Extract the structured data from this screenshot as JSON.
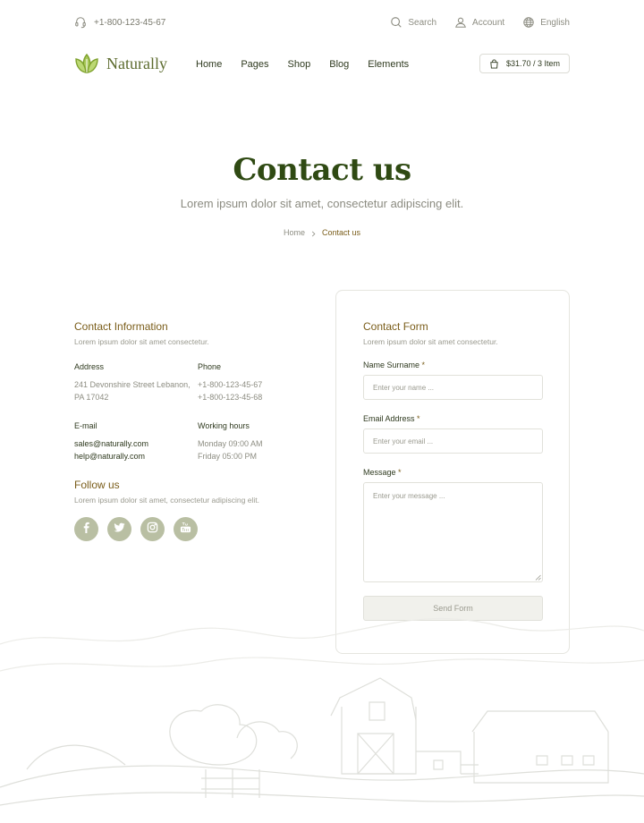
{
  "topbar": {
    "phone": "+1-800-123-45-67",
    "search_label": "Search",
    "account_label": "Account",
    "language_label": "English"
  },
  "brand": {
    "name": "Naturally"
  },
  "nav": {
    "items": [
      {
        "label": "Home"
      },
      {
        "label": "Pages"
      },
      {
        "label": "Shop"
      },
      {
        "label": "Blog"
      },
      {
        "label": "Elements"
      }
    ]
  },
  "cart": {
    "label": "$31.70 / 3 Item"
  },
  "hero": {
    "title": "Contact us",
    "subtitle": "Lorem ipsum dolor sit amet, consectetur adipiscing elit.",
    "breadcrumb": {
      "home": "Home",
      "current": "Contact us"
    }
  },
  "contact_info": {
    "title": "Contact Information",
    "subtitle": "Lorem ipsum dolor sit amet consectetur.",
    "address": {
      "label": "Address",
      "lines": [
        "241 Devonshire Street Lebanon,",
        "PA 17042"
      ]
    },
    "phone": {
      "label": "Phone",
      "lines": [
        "+1-800-123-45-67",
        "+1-800-123-45-68"
      ]
    },
    "email": {
      "label": "E-mail",
      "lines": [
        "sales@naturally.com",
        "help@naturally.com"
      ]
    },
    "hours": {
      "label": "Working hours",
      "lines": [
        "Monday 09:00 AM",
        "Friday 05:00 PM"
      ]
    }
  },
  "follow": {
    "title": "Follow us",
    "subtitle": "Lorem ipsum dolor sit amet, consectetur adipiscing elit.",
    "icons": [
      "facebook-icon",
      "twitter-icon",
      "instagram-icon",
      "youtube-icon"
    ]
  },
  "form": {
    "title": "Contact Form",
    "subtitle": "Lorem ipsum dolor sit amet consectetur.",
    "name_label": "Name Surname",
    "name_placeholder": "Enter your name ...",
    "email_label": "Email Address",
    "email_placeholder": "Enter your email ...",
    "message_label": "Message",
    "message_placeholder": "Enter your message ...",
    "required_mark": "*",
    "submit_label": "Send Form"
  },
  "colors": {
    "brand_green": "#5c6b2e",
    "heading_dark_green": "#2f4a13",
    "accent_brown": "#7a5d1a",
    "social_bg": "#b9bfa3"
  }
}
